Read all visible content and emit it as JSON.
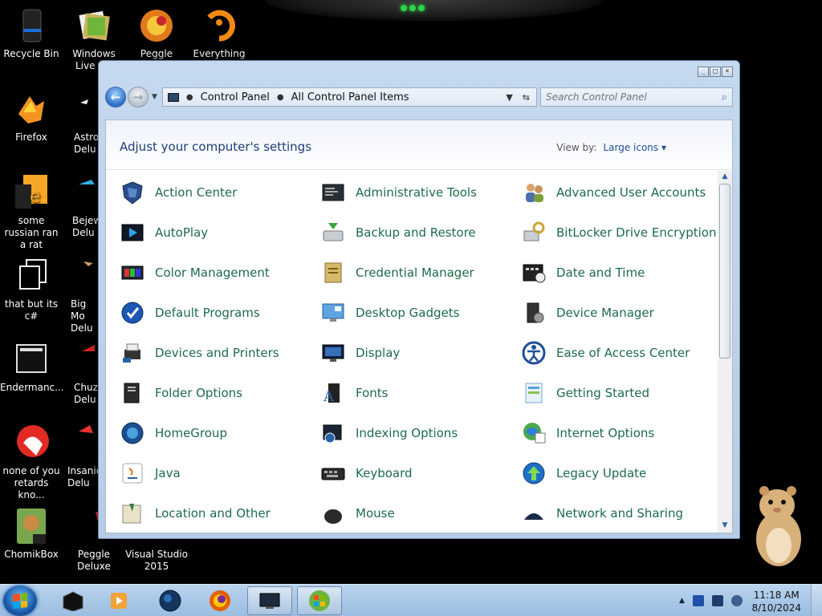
{
  "desktop": {
    "icons": [
      {
        "label": "Recycle Bin"
      },
      {
        "label": "Windows Live Ma"
      },
      {
        "label": "Peggle World"
      },
      {
        "label": "Everything"
      },
      {
        "label": "Firefox"
      },
      {
        "label": "Astro Delu"
      },
      {
        "label": "some russian ran a rat"
      },
      {
        "label": "Bejew Delu"
      },
      {
        "label": "that but its c#"
      },
      {
        "label": "Big Mo Delu"
      },
      {
        "label": "Endermanc..."
      },
      {
        "label": "Chuz Delu"
      },
      {
        "label": "none of you retards kno..."
      },
      {
        "label": "Insaniq Delu"
      },
      {
        "label": "ChomikBox"
      },
      {
        "label": "Peggle Deluxe"
      },
      {
        "label": "Visual Studio 2015"
      }
    ]
  },
  "window": {
    "breadcrumb": [
      "Control Panel",
      "All Control Panel Items"
    ],
    "search_placeholder": "Search Control Panel",
    "title": "Adjust your computer's settings",
    "view_by_label": "View by:",
    "view_by_value": "Large icons",
    "items": [
      {
        "label": "Action Center",
        "icon": "shield-flag-icon"
      },
      {
        "label": "Administrative Tools",
        "icon": "admin-tools-icon"
      },
      {
        "label": "Advanced User Accounts",
        "icon": "users-icon"
      },
      {
        "label": "AutoPlay",
        "icon": "autoplay-icon"
      },
      {
        "label": "Backup and Restore",
        "icon": "backup-icon"
      },
      {
        "label": "BitLocker Drive Encryption",
        "icon": "bitlocker-icon"
      },
      {
        "label": "Color Management",
        "icon": "color-management-icon"
      },
      {
        "label": "Credential Manager",
        "icon": "credential-icon"
      },
      {
        "label": "Date and Time",
        "icon": "calendar-clock-icon"
      },
      {
        "label": "Default Programs",
        "icon": "default-programs-icon"
      },
      {
        "label": "Desktop Gadgets",
        "icon": "gadgets-icon"
      },
      {
        "label": "Device Manager",
        "icon": "device-manager-icon"
      },
      {
        "label": "Devices and Printers",
        "icon": "printer-icon"
      },
      {
        "label": "Display",
        "icon": "display-icon"
      },
      {
        "label": "Ease of Access Center",
        "icon": "ease-of-access-icon"
      },
      {
        "label": "Folder Options",
        "icon": "folder-options-icon"
      },
      {
        "label": "Fonts",
        "icon": "fonts-icon"
      },
      {
        "label": "Getting Started",
        "icon": "getting-started-icon"
      },
      {
        "label": "HomeGroup",
        "icon": "homegroup-icon"
      },
      {
        "label": "Indexing Options",
        "icon": "indexing-icon"
      },
      {
        "label": "Internet Options",
        "icon": "internet-options-icon"
      },
      {
        "label": "Java",
        "icon": "java-icon"
      },
      {
        "label": "Keyboard",
        "icon": "keyboard-icon"
      },
      {
        "label": "Legacy Update",
        "icon": "update-arrow-icon"
      },
      {
        "label": "Location and Other",
        "icon": "location-icon"
      },
      {
        "label": "Mouse",
        "icon": "mouse-icon"
      },
      {
        "label": "Network and Sharing",
        "icon": "network-icon"
      }
    ]
  },
  "taskbar": {
    "clock_time": "11:18 AM",
    "clock_date": "8/10/2024"
  },
  "colors": {
    "item_text": "#1d6b48",
    "title_text": "#1e3e78",
    "taskbar": "#9bbde0"
  }
}
